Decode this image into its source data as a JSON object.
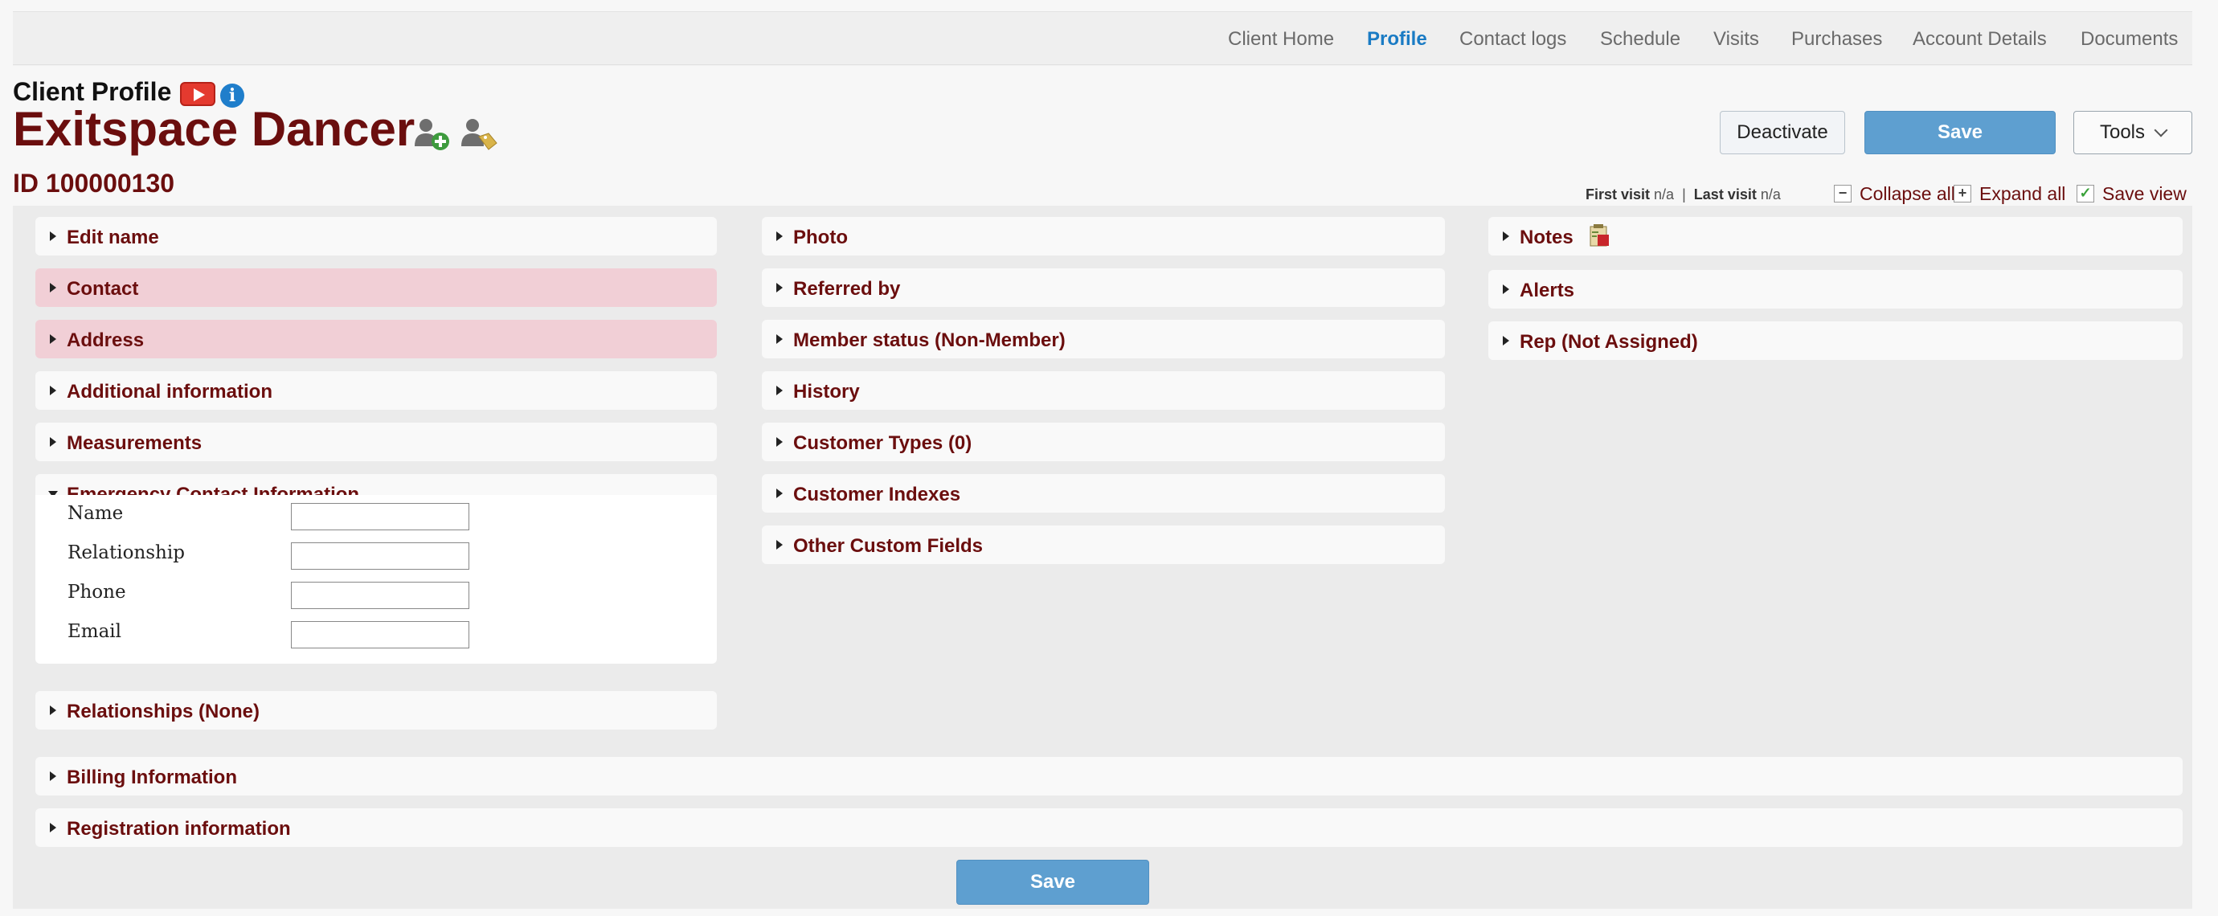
{
  "nav": {
    "items": [
      {
        "label": "Client Home",
        "active": false
      },
      {
        "label": "Profile",
        "active": true
      },
      {
        "label": "Contact logs",
        "active": false
      },
      {
        "label": "Schedule",
        "active": false
      },
      {
        "label": "Visits",
        "active": false
      },
      {
        "label": "Purchases",
        "active": false
      },
      {
        "label": "Account Details",
        "active": false
      },
      {
        "label": "Documents",
        "active": false
      }
    ]
  },
  "header": {
    "subtitle": "Client Profile",
    "info_glyph": "i",
    "client_name": "Exitspace Dancer",
    "client_id": "ID 100000130",
    "icons": [
      "youtube-video-icon",
      "info-icon",
      "add-user-icon",
      "tag-user-icon"
    ]
  },
  "toolbar": {
    "deactivate_label": "Deactivate",
    "save_label": "Save",
    "tools_label": "Tools"
  },
  "visits": {
    "first_label": "First visit",
    "first_value": "n/a",
    "separator": "|",
    "last_label": "Last visit",
    "last_value": "n/a"
  },
  "view_controls": {
    "collapse_label": "Collapse all",
    "collapse_glyph": "−",
    "expand_label": "Expand all",
    "expand_glyph": "+",
    "save_view_label": "Save view",
    "save_view_glyph": "✓"
  },
  "panels": {
    "left": [
      {
        "title": "Edit name",
        "alert": false
      },
      {
        "title": "Contact",
        "alert": true
      },
      {
        "title": "Address",
        "alert": true
      },
      {
        "title": "Additional information",
        "alert": false
      },
      {
        "title": "Measurements",
        "alert": false
      },
      {
        "title": "Emergency Contact Information",
        "alert": false,
        "expanded": true
      },
      {
        "title": "Relationships (None)",
        "alert": false
      }
    ],
    "middle": [
      {
        "title": "Photo"
      },
      {
        "title": "Referred by"
      },
      {
        "title": "Member status (Non-Member)"
      },
      {
        "title": "History"
      },
      {
        "title": "Customer Types (0)"
      },
      {
        "title": "Customer Indexes"
      },
      {
        "title": "Other Custom Fields"
      }
    ],
    "right": [
      {
        "title": "Notes"
      },
      {
        "title": "Alerts"
      },
      {
        "title": "Rep (Not Assigned)"
      }
    ],
    "full": [
      {
        "title": "Billing Information"
      },
      {
        "title": "Registration information"
      }
    ]
  },
  "emergency_contact": {
    "fields": [
      {
        "label": "Name",
        "value": ""
      },
      {
        "label": "Relationship",
        "value": ""
      },
      {
        "label": "Phone",
        "value": ""
      },
      {
        "label": "Email",
        "value": ""
      }
    ]
  },
  "footer": {
    "save_label": "Save"
  },
  "colors": {
    "accent": "#6b0e0e",
    "active_nav": "#1a7bc4",
    "save_button": "#5e9fd0",
    "alert_panel": "#f1cfd6"
  }
}
